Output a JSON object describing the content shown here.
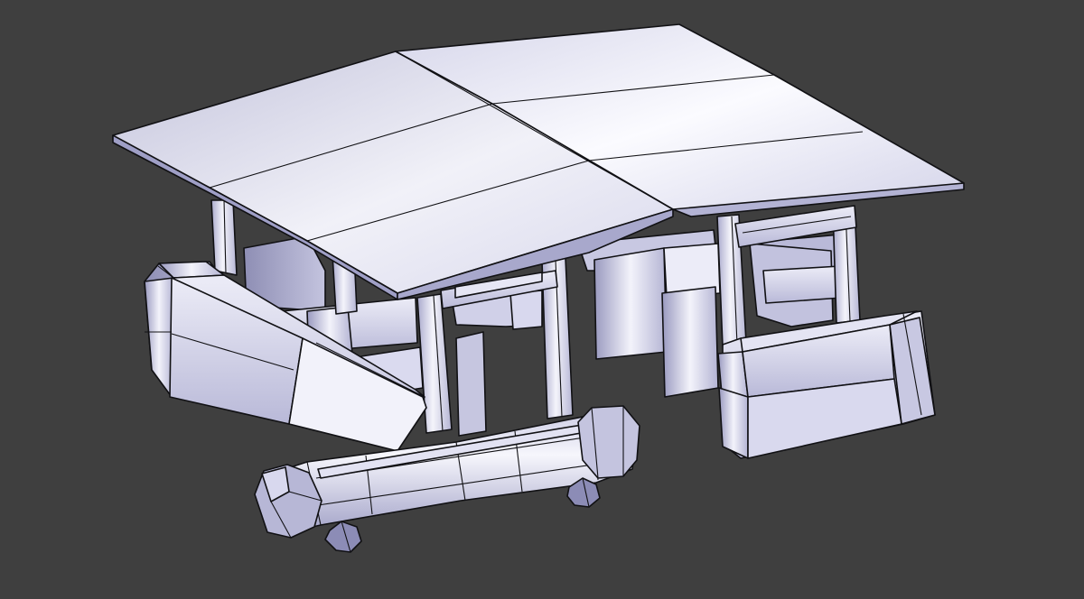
{
  "scene": {
    "view": "3d-viewport",
    "object": "roofed-shelter-model",
    "shading": "solid-with-wireframe-edges",
    "colors": {
      "background": "#3f3f3f",
      "edge": "#111114",
      "surface_light": "#f3f3fb",
      "surface_mid": "#c9c9e4",
      "surface_dark": "#8e8eb4"
    }
  }
}
